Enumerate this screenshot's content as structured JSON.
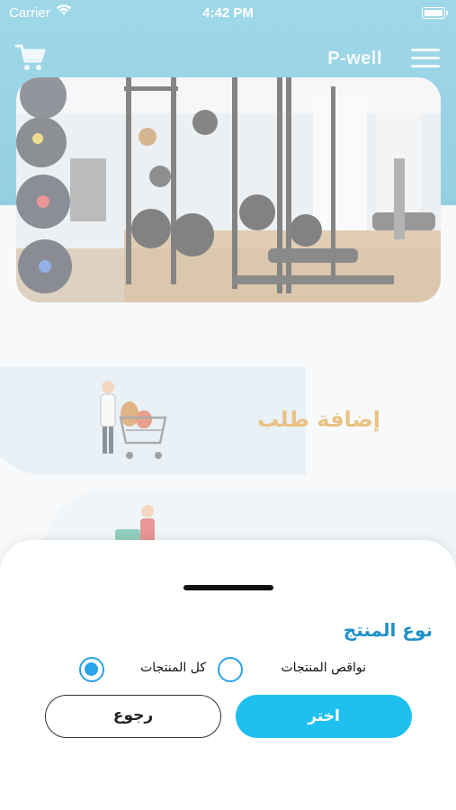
{
  "status_bar": {
    "carrier": "Carrier",
    "time": "4:42 PM"
  },
  "header": {
    "title": "P-well"
  },
  "main": {
    "actions": [
      {
        "label": "إضافة طلب"
      },
      {
        "label": ""
      }
    ]
  },
  "sheet": {
    "title": "نوع المنتج",
    "options": [
      {
        "label": "نواقص المنتجات",
        "selected": false
      },
      {
        "label": "كل المنتجات",
        "selected": true
      }
    ],
    "choose_label": "اختر",
    "back_label": "رجوع"
  },
  "colors": {
    "header": "#3ea7c9",
    "accent": "#1fc0f0",
    "radio": "#2aa3e8",
    "title": "#1e90c8",
    "action_text": "#d8901f"
  },
  "icons": {
    "cart": "cart-icon",
    "menu": "menu-icon",
    "wifi": "wifi-icon",
    "battery": "battery-icon"
  }
}
